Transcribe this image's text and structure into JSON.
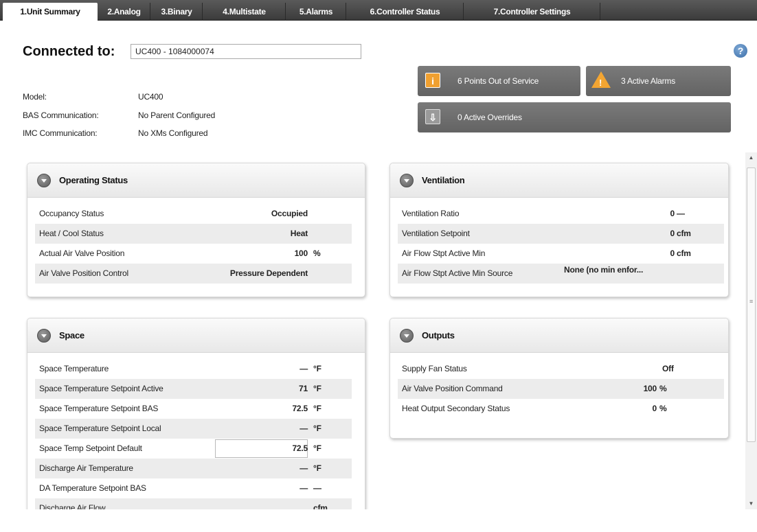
{
  "tabs": [
    {
      "label": "1.Unit Summary"
    },
    {
      "label": "2.Analog"
    },
    {
      "label": "3.Binary"
    },
    {
      "label": "4.Multistate"
    },
    {
      "label": "5.Alarms"
    },
    {
      "label": "6.Controller Status"
    },
    {
      "label": "7.Controller Settings"
    }
  ],
  "header": {
    "connected_label": "Connected to:",
    "connected_value": "UC400 - 1084000074",
    "help_glyph": "?"
  },
  "info": {
    "model_label": "Model:",
    "model_value": "UC400",
    "bas_label": "BAS Communication:",
    "bas_value": "No Parent Configured",
    "imc_label": "IMC Communication:",
    "imc_value": "No XMs Configured"
  },
  "status_buttons": {
    "out_of_service": "6  Points Out of Service",
    "active_alarms": "3  Active Alarms",
    "active_overrides": "0  Active Overrides",
    "info_glyph": "i",
    "alarm_glyph": "!",
    "override_glyph": "⇩"
  },
  "colors": {
    "info_icon": "#f0a030",
    "alarm_icon": "#f3a532",
    "override_icon": "#9a9a9a"
  },
  "panels": {
    "operating": {
      "title": "Operating Status",
      "rows": [
        {
          "label": "Occupancy Status",
          "value": "Occupied",
          "unit": ""
        },
        {
          "label": "Heat / Cool Status",
          "value": "Heat",
          "unit": ""
        },
        {
          "label": "Actual Air Valve Position",
          "value": "100",
          "unit": "%"
        },
        {
          "label": "Air Valve Position Control",
          "value": "Pressure Dependent",
          "unit": ""
        }
      ]
    },
    "ventilation": {
      "title": "Ventilation",
      "rows": [
        {
          "label": "Ventilation Ratio",
          "value": "0",
          "unit": "—"
        },
        {
          "label": "Ventilation Setpoint",
          "value": "0",
          "unit": "cfm"
        },
        {
          "label": "Air Flow Stpt Active Min",
          "value": "0",
          "unit": "cfm"
        },
        {
          "label": "Air Flow Stpt Active Min Source",
          "value": "None (no min enfor...",
          "unit": ""
        }
      ]
    },
    "space": {
      "title": "Space",
      "rows": [
        {
          "label": "Space Temperature",
          "value": "—",
          "unit": "°F"
        },
        {
          "label": "Space Temperature Setpoint Active",
          "value": "71",
          "unit": "°F"
        },
        {
          "label": "Space Temperature Setpoint BAS",
          "value": "72.5",
          "unit": "°F"
        },
        {
          "label": "Space Temperature Setpoint Local",
          "value": "—",
          "unit": "°F"
        },
        {
          "label": "Space Temp Setpoint Default",
          "value": "72.5",
          "unit": "°F"
        },
        {
          "label": "Discharge Air Temperature",
          "value": "—",
          "unit": "°F"
        },
        {
          "label": "DA Temperature Setpoint BAS",
          "value": "—",
          "unit": "—"
        },
        {
          "label": "Discharge Air Flow",
          "value": "",
          "unit": "cfm"
        }
      ]
    },
    "outputs": {
      "title": "Outputs",
      "rows": [
        {
          "label": "Supply Fan Status",
          "value": "Off",
          "unit": ""
        },
        {
          "label": "Air Valve Position Command",
          "value": "100",
          "unit": "%"
        },
        {
          "label": "Heat Output Secondary Status",
          "value": "0",
          "unit": "%"
        }
      ]
    }
  }
}
